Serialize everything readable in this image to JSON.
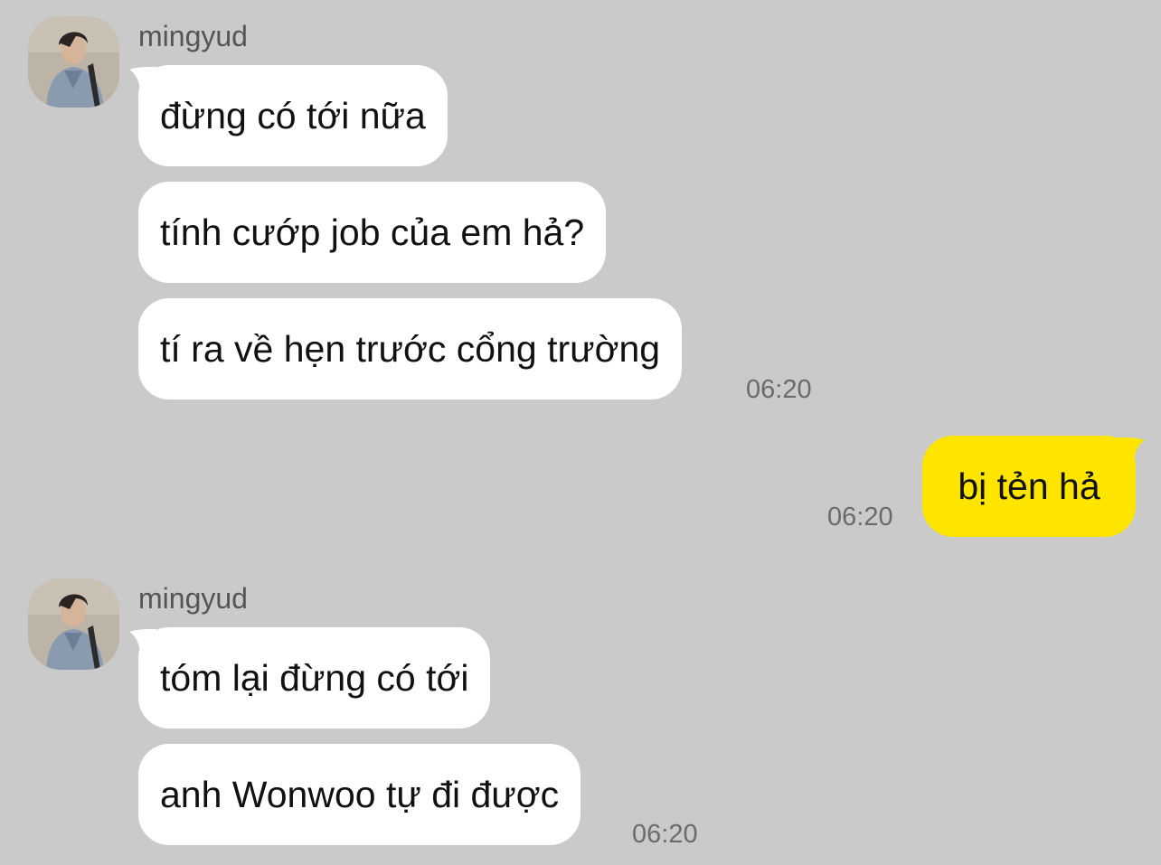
{
  "conversation": {
    "groups": [
      {
        "sender": "mingyud",
        "messages": [
          {
            "text": "đừng có tới nữa"
          },
          {
            "text": "tính cướp job của em hả?"
          },
          {
            "text": "tí ra về hẹn trước cổng trường"
          }
        ],
        "time": "06:20"
      },
      {
        "sender": "me",
        "messages": [
          {
            "text": "bị tẻn hả"
          }
        ],
        "time": "06:20"
      },
      {
        "sender": "mingyud",
        "messages": [
          {
            "text": "tóm lại đừng có tới"
          },
          {
            "text": "anh Wonwoo tự đi được"
          }
        ],
        "time": "06:20"
      }
    ]
  },
  "colors": {
    "background": "#cacaca",
    "incoming_bubble": "#ffffff",
    "outgoing_bubble": "#fee500",
    "timestamp": "#6b6b6b",
    "sender_name": "#555555"
  },
  "icons": {
    "avatar": "profile-photo-avatar"
  }
}
